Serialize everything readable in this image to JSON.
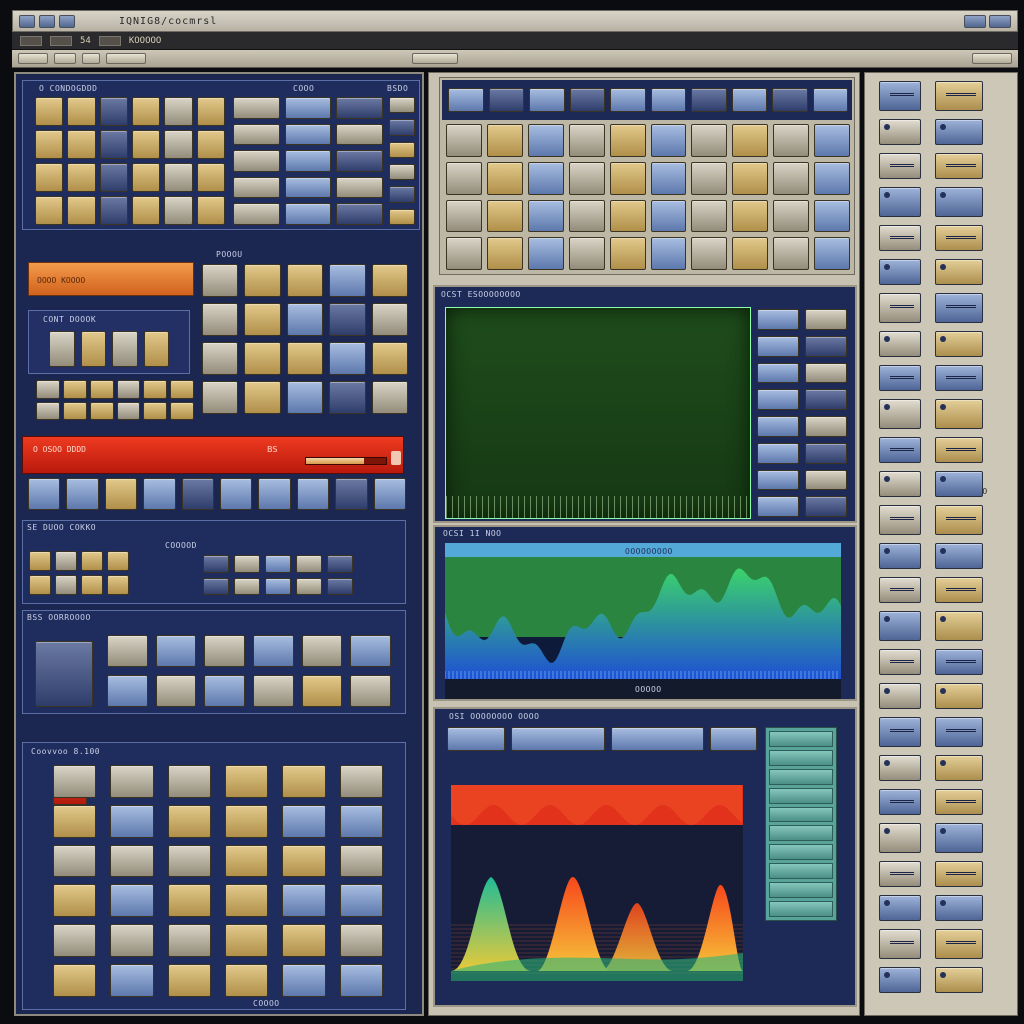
{
  "window": {
    "title": "IQNIG8/cocmrsl",
    "menu_text": "KOOOOO",
    "menu_num": "54"
  },
  "left": {
    "top_header": "O CONDOGDDD",
    "top_header_2": "COOO",
    "top_header_3": "BSDO",
    "mid_header": "POOOU",
    "orange_label": "OOOO KOOOO",
    "cont_label": "CONT DOOOK",
    "red_label": "O OSOO  DDDD",
    "red_label_2": "BS",
    "red_fill": 0.72,
    "ctrl_label": "SE DUOO  COKKO",
    "ctrl_label_2": "COOOOD",
    "bss_label": "BSS OORROOOO",
    "bottom_header": "Coovvoo 8.100",
    "bottom_foot": "COOOO"
  },
  "center": {
    "scope_label": "OCST ESOOOOOOOO",
    "spec1_label": "OCSI 1I  NOO",
    "spec1_sub": "OOOOOOOOO",
    "spec1_foot": "OOOOO",
    "spec2_label": "OSI OOOOOOOO OOOO",
    "colors": {
      "spectrum_fill_top": "#3bd36b",
      "spectrum_fill_bottom": "#1f4fd4",
      "heat_top": "#e3321b",
      "peak_a": "#22c49a",
      "peak_b": "#f7471b"
    }
  },
  "right": {
    "small_label": "OO"
  }
}
